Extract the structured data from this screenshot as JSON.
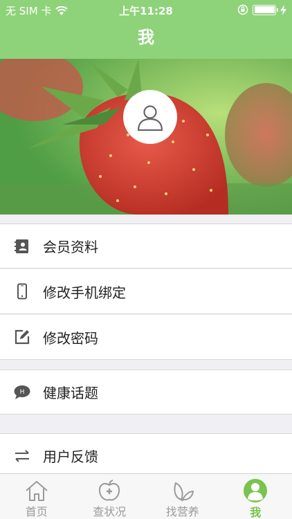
{
  "status_bar": {
    "carrier": "无 SIM 卡",
    "time": "上午11:28",
    "wifi_icon": "wifi-icon",
    "lock_icon": "orientation-lock-icon",
    "charging_icon": "charging-bolt-icon",
    "battery_level": 1.0
  },
  "nav": {
    "title": "我"
  },
  "banner": {
    "avatar_icon": "user-avatar-icon"
  },
  "menu": {
    "group1": [
      {
        "label": "会员资料",
        "icon": "address-book-icon"
      },
      {
        "label": "修改手机绑定",
        "icon": "phone-icon"
      },
      {
        "label": "修改密码",
        "icon": "edit-icon"
      }
    ],
    "group2": [
      {
        "label": "健康话题",
        "icon": "chat-bubble-icon"
      }
    ],
    "group3": [
      {
        "label": "用户反馈",
        "icon": "exchange-icon"
      }
    ]
  },
  "tabs": [
    {
      "label": "首页",
      "icon": "home-icon",
      "active": false
    },
    {
      "label": "查状况",
      "icon": "apple-health-icon",
      "active": false
    },
    {
      "label": "找营养",
      "icon": "leaf-icon",
      "active": false
    },
    {
      "label": "我",
      "icon": "profile-icon",
      "active": true
    }
  ],
  "colors": {
    "accent": "#8ed37a",
    "active_tab": "#79c34e",
    "icon_gray": "#555555"
  }
}
